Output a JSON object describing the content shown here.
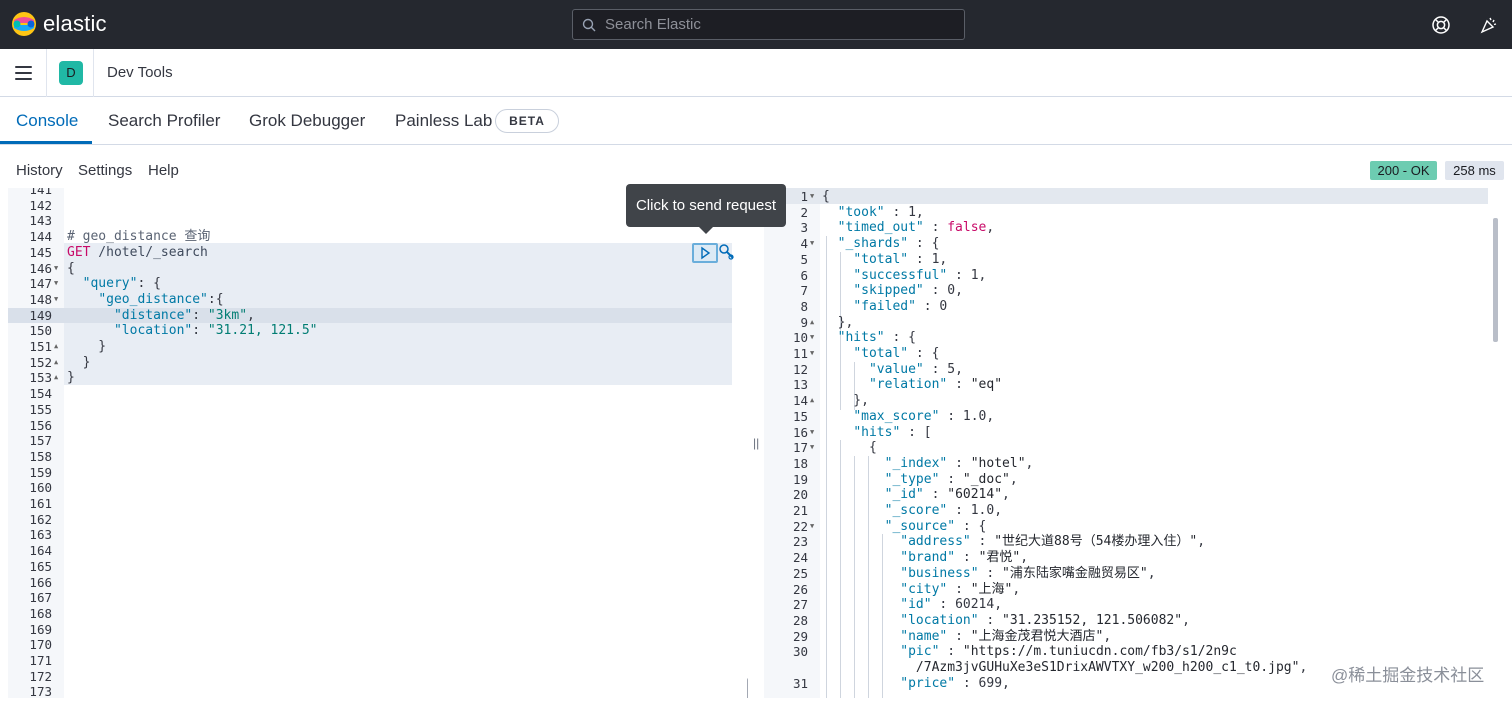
{
  "header": {
    "brand": "elastic",
    "search_placeholder": "Search Elastic",
    "icons": [
      "help-icon",
      "newsfeed-icon"
    ]
  },
  "breadcrumb": {
    "avatar_letter": "D",
    "title": "Dev Tools"
  },
  "tabs": [
    {
      "label": "Console",
      "active": true
    },
    {
      "label": "Search Profiler",
      "active": false
    },
    {
      "label": "Grok Debugger",
      "active": false
    },
    {
      "label": "Painless Lab",
      "active": false
    }
  ],
  "beta_badge": "BETA",
  "toolbar": {
    "history": "History",
    "settings": "Settings",
    "help": "Help",
    "status": "200 - OK",
    "duration": "258 ms"
  },
  "tooltip": "Click to send request",
  "watermark": "@稀土掘金技术社区",
  "request_editor": {
    "lines": [
      {
        "n": "141",
        "text": ""
      },
      {
        "n": "142",
        "text": ""
      },
      {
        "n": "143",
        "text": ""
      },
      {
        "n": "144",
        "text": "# geo_distance 查询",
        "cls": "k-comment"
      },
      {
        "n": "145",
        "parts": [
          [
            "GET",
            "k-method"
          ],
          [
            " /hotel/_search",
            "k-url"
          ]
        ]
      },
      {
        "n": "146",
        "fold": "down",
        "text": "{",
        "cls": "k-punc"
      },
      {
        "n": "147",
        "fold": "down",
        "parts": [
          [
            "  ",
            ""
          ],
          [
            "\"query\"",
            "k-key"
          ],
          [
            ": {",
            "k-punc"
          ]
        ]
      },
      {
        "n": "148",
        "fold": "down",
        "parts": [
          [
            "    ",
            ""
          ],
          [
            "\"geo_distance\"",
            "k-key"
          ],
          [
            ":{",
            "k-punc"
          ]
        ]
      },
      {
        "n": "149",
        "active": true,
        "parts": [
          [
            "      ",
            ""
          ],
          [
            "\"distance\"",
            "k-key"
          ],
          [
            ": ",
            "k-punc"
          ],
          [
            "\"3km\"",
            "k-str"
          ],
          [
            ",",
            "k-punc"
          ]
        ]
      },
      {
        "n": "150",
        "parts": [
          [
            "      ",
            ""
          ],
          [
            "\"location\"",
            "k-key"
          ],
          [
            ": ",
            "k-punc"
          ],
          [
            "\"31.21, 121.5\"",
            "k-str"
          ]
        ]
      },
      {
        "n": "151",
        "fold": "up",
        "text": "    }",
        "cls": "k-punc"
      },
      {
        "n": "152",
        "fold": "up",
        "text": "  }",
        "cls": "k-punc"
      },
      {
        "n": "153",
        "fold": "up",
        "text": "}",
        "cls": "k-punc"
      },
      {
        "n": "154",
        "text": ""
      },
      {
        "n": "155",
        "text": ""
      },
      {
        "n": "156",
        "text": ""
      },
      {
        "n": "157",
        "text": ""
      },
      {
        "n": "158",
        "text": ""
      },
      {
        "n": "159",
        "text": ""
      },
      {
        "n": "160",
        "text": ""
      },
      {
        "n": "161",
        "text": ""
      },
      {
        "n": "162",
        "text": ""
      },
      {
        "n": "163",
        "text": ""
      },
      {
        "n": "164",
        "text": ""
      },
      {
        "n": "165",
        "text": ""
      },
      {
        "n": "166",
        "text": ""
      },
      {
        "n": "167",
        "text": ""
      },
      {
        "n": "168",
        "text": ""
      },
      {
        "n": "169",
        "text": ""
      },
      {
        "n": "170",
        "text": ""
      },
      {
        "n": "171",
        "text": ""
      },
      {
        "n": "172",
        "text": ""
      },
      {
        "n": "173",
        "text": ""
      }
    ]
  },
  "response_editor": {
    "lines": [
      {
        "n": "1",
        "fold": "down",
        "text": "{",
        "cls": "k-punc"
      },
      {
        "n": "2",
        "parts": [
          [
            "  ",
            ""
          ],
          [
            "\"took\"",
            "k-key"
          ],
          [
            " : 1,",
            "k-num"
          ]
        ]
      },
      {
        "n": "3",
        "parts": [
          [
            "  ",
            ""
          ],
          [
            "\"timed_out\"",
            "k-key"
          ],
          [
            " : ",
            "k-punc"
          ],
          [
            "false",
            "k-bool"
          ],
          [
            ",",
            "k-punc"
          ]
        ]
      },
      {
        "n": "4",
        "fold": "down",
        "parts": [
          [
            "  ",
            ""
          ],
          [
            "\"_shards\"",
            "k-key"
          ],
          [
            " : {",
            "k-punc"
          ]
        ]
      },
      {
        "n": "5",
        "parts": [
          [
            "    ",
            ""
          ],
          [
            "\"total\"",
            "k-key"
          ],
          [
            " : 1,",
            "k-num"
          ]
        ]
      },
      {
        "n": "6",
        "parts": [
          [
            "    ",
            ""
          ],
          [
            "\"successful\"",
            "k-key"
          ],
          [
            " : 1,",
            "k-num"
          ]
        ]
      },
      {
        "n": "7",
        "parts": [
          [
            "    ",
            ""
          ],
          [
            "\"skipped\"",
            "k-key"
          ],
          [
            " : 0,",
            "k-num"
          ]
        ]
      },
      {
        "n": "8",
        "parts": [
          [
            "    ",
            ""
          ],
          [
            "\"failed\"",
            "k-key"
          ],
          [
            " : 0",
            "k-num"
          ]
        ]
      },
      {
        "n": "9",
        "fold": "up",
        "text": "  },",
        "cls": "k-punc"
      },
      {
        "n": "10",
        "fold": "down",
        "parts": [
          [
            "  ",
            ""
          ],
          [
            "\"hits\"",
            "k-key"
          ],
          [
            " : {",
            "k-punc"
          ]
        ]
      },
      {
        "n": "11",
        "fold": "down",
        "parts": [
          [
            "    ",
            ""
          ],
          [
            "\"total\"",
            "k-key"
          ],
          [
            " : {",
            "k-punc"
          ]
        ]
      },
      {
        "n": "12",
        "parts": [
          [
            "      ",
            ""
          ],
          [
            "\"value\"",
            "k-key"
          ],
          [
            " : 5,",
            "k-num"
          ]
        ]
      },
      {
        "n": "13",
        "parts": [
          [
            "      ",
            ""
          ],
          [
            "\"relation\"",
            "k-key"
          ],
          [
            " : ",
            "k-punc"
          ],
          [
            "\"eq\"",
            "k-str2"
          ]
        ]
      },
      {
        "n": "14",
        "fold": "up",
        "text": "    },",
        "cls": "k-punc"
      },
      {
        "n": "15",
        "parts": [
          [
            "    ",
            ""
          ],
          [
            "\"max_score\"",
            "k-key"
          ],
          [
            " : 1.0,",
            "k-num"
          ]
        ]
      },
      {
        "n": "16",
        "fold": "down",
        "parts": [
          [
            "    ",
            ""
          ],
          [
            "\"hits\"",
            "k-key"
          ],
          [
            " : [",
            "k-punc"
          ]
        ]
      },
      {
        "n": "17",
        "fold": "down",
        "text": "      {",
        "cls": "k-punc"
      },
      {
        "n": "18",
        "parts": [
          [
            "        ",
            ""
          ],
          [
            "\"_index\"",
            "k-key"
          ],
          [
            " : ",
            "k-punc"
          ],
          [
            "\"hotel\"",
            "k-str2"
          ],
          [
            ",",
            "k-punc"
          ]
        ]
      },
      {
        "n": "19",
        "parts": [
          [
            "        ",
            ""
          ],
          [
            "\"_type\"",
            "k-key"
          ],
          [
            " : ",
            "k-punc"
          ],
          [
            "\"_doc\"",
            "k-str2"
          ],
          [
            ",",
            "k-punc"
          ]
        ]
      },
      {
        "n": "20",
        "parts": [
          [
            "        ",
            ""
          ],
          [
            "\"_id\"",
            "k-key"
          ],
          [
            " : ",
            "k-punc"
          ],
          [
            "\"60214\"",
            "k-str2"
          ],
          [
            ",",
            "k-punc"
          ]
        ]
      },
      {
        "n": "21",
        "parts": [
          [
            "        ",
            ""
          ],
          [
            "\"_score\"",
            "k-key"
          ],
          [
            " : 1.0,",
            "k-num"
          ]
        ]
      },
      {
        "n": "22",
        "fold": "down",
        "parts": [
          [
            "        ",
            ""
          ],
          [
            "\"_source\"",
            "k-key"
          ],
          [
            " : {",
            "k-punc"
          ]
        ]
      },
      {
        "n": "23",
        "parts": [
          [
            "          ",
            ""
          ],
          [
            "\"address\"",
            "k-key"
          ],
          [
            " : ",
            "k-punc"
          ],
          [
            "\"世纪大道88号（54楼办理入住）\"",
            "k-str2"
          ],
          [
            ",",
            "k-punc"
          ]
        ]
      },
      {
        "n": "24",
        "parts": [
          [
            "          ",
            ""
          ],
          [
            "\"brand\"",
            "k-key"
          ],
          [
            " : ",
            "k-punc"
          ],
          [
            "\"君悦\"",
            "k-str2"
          ],
          [
            ",",
            "k-punc"
          ]
        ]
      },
      {
        "n": "25",
        "parts": [
          [
            "          ",
            ""
          ],
          [
            "\"business\"",
            "k-key"
          ],
          [
            " : ",
            "k-punc"
          ],
          [
            "\"浦东陆家嘴金融贸易区\"",
            "k-str2"
          ],
          [
            ",",
            "k-punc"
          ]
        ]
      },
      {
        "n": "26",
        "parts": [
          [
            "          ",
            ""
          ],
          [
            "\"city\"",
            "k-key"
          ],
          [
            " : ",
            "k-punc"
          ],
          [
            "\"上海\"",
            "k-str2"
          ],
          [
            ",",
            "k-punc"
          ]
        ]
      },
      {
        "n": "27",
        "parts": [
          [
            "          ",
            ""
          ],
          [
            "\"id\"",
            "k-key"
          ],
          [
            " : 60214,",
            "k-num"
          ]
        ]
      },
      {
        "n": "28",
        "parts": [
          [
            "          ",
            ""
          ],
          [
            "\"location\"",
            "k-key"
          ],
          [
            " : ",
            "k-punc"
          ],
          [
            "\"31.235152, 121.506082\"",
            "k-str2"
          ],
          [
            ",",
            "k-punc"
          ]
        ]
      },
      {
        "n": "29",
        "parts": [
          [
            "          ",
            ""
          ],
          [
            "\"name\"",
            "k-key"
          ],
          [
            " : ",
            "k-punc"
          ],
          [
            "\"上海金茂君悦大酒店\"",
            "k-str2"
          ],
          [
            ",",
            "k-punc"
          ]
        ]
      },
      {
        "n": "30",
        "parts": [
          [
            "          ",
            ""
          ],
          [
            "\"pic\"",
            "k-key"
          ],
          [
            " : ",
            "k-punc"
          ],
          [
            "\"https://m.tuniucdn.com/fb3/s1/2n9c",
            "k-str2"
          ]
        ]
      },
      {
        "n": "",
        "parts": [
          [
            "            ",
            ""
          ],
          [
            "/7Azm3jvGUHuXe3eS1DrixAWVTXY_w200_h200_c1_t0.jpg\"",
            "k-str2"
          ],
          [
            ",",
            "k-punc"
          ]
        ]
      },
      {
        "n": "31",
        "parts": [
          [
            "          ",
            ""
          ],
          [
            "\"price\"",
            "k-key"
          ],
          [
            " : 699,",
            "k-num"
          ]
        ]
      }
    ]
  }
}
